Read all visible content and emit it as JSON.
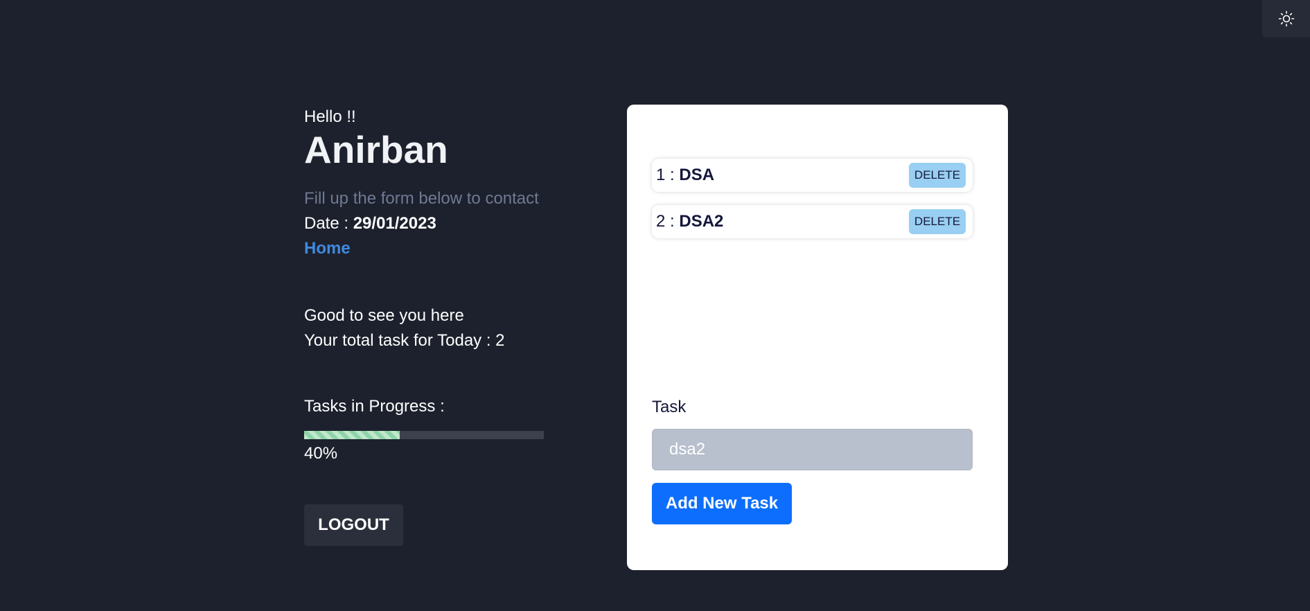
{
  "theme_toggle": {
    "icon": "sun-icon"
  },
  "profile": {
    "greeting": "Hello !!",
    "name": "Anirban",
    "subtitle": "Fill up the form below to contact",
    "date_label": "Date : ",
    "date_value": "29/01/2023",
    "home_link": "Home"
  },
  "summary": {
    "welcome": "Good to see you here",
    "total_tasks": "Your total task for Today : 2"
  },
  "progress": {
    "label": "Tasks in Progress :",
    "value": 0.4,
    "text": "40%"
  },
  "logout_label": "LOGOUT",
  "tasks": [
    {
      "index": "1 : ",
      "name": "DSA",
      "delete_label": "DELETE"
    },
    {
      "index": "2 : ",
      "name": "DSA2",
      "delete_label": "DELETE"
    }
  ],
  "form": {
    "task_label": "Task",
    "task_value": "dsa2",
    "add_label": "Add New Task"
  }
}
